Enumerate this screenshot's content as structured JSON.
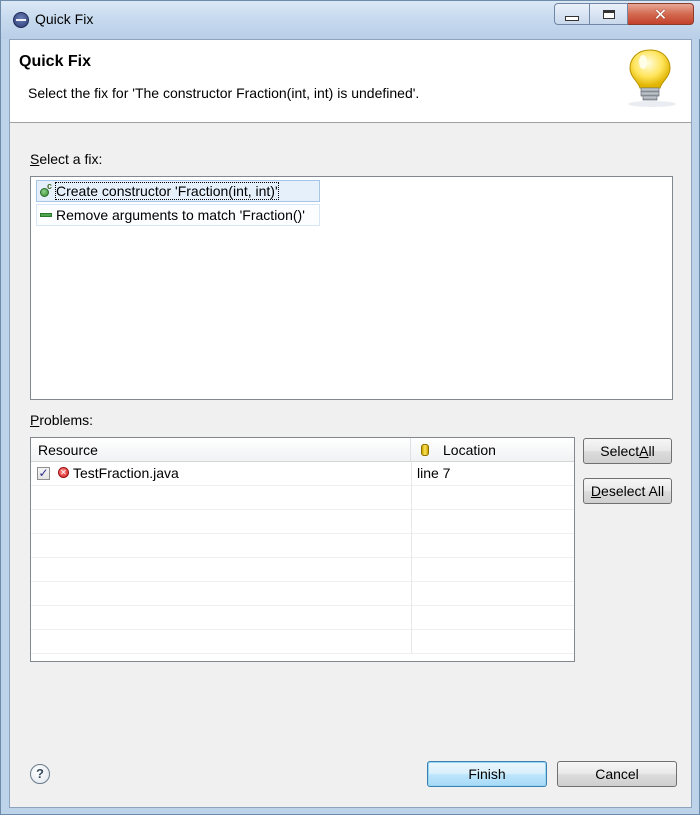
{
  "window": {
    "title": "Quick Fix",
    "controls": {
      "minimize": "minimize",
      "maximize": "maximize",
      "close": "close"
    }
  },
  "banner": {
    "title": "Quick Fix",
    "message": "Select the fix for 'The constructor Fraction(int, int) is undefined'."
  },
  "fixes": {
    "label_prefix": "S",
    "label_rest": "elect a fix:",
    "items": [
      {
        "label": "Create constructor 'Fraction(int, int)'",
        "icon": "constructor-icon",
        "selected": true
      },
      {
        "label": "Remove arguments to match 'Fraction()'",
        "icon": "remove-icon",
        "selected": false
      }
    ]
  },
  "problems": {
    "label_prefix": "P",
    "label_rest": "roblems:",
    "columns": {
      "resource": "Resource",
      "location": "Location"
    },
    "rows": [
      {
        "checked": true,
        "resource": "TestFraction.java",
        "location": "line 7",
        "severity": "error"
      }
    ]
  },
  "buttons": {
    "select_all_a": "Select ",
    "select_all_b": "A",
    "select_all_c": "ll",
    "deselect_all_a": "D",
    "deselect_all_b": "eselect All",
    "finish": "Finish",
    "cancel": "Cancel",
    "help": "?"
  },
  "colors": {
    "selection": "#e5f0fb",
    "default_button": "#bee6fd",
    "error": "#d41c1c"
  }
}
